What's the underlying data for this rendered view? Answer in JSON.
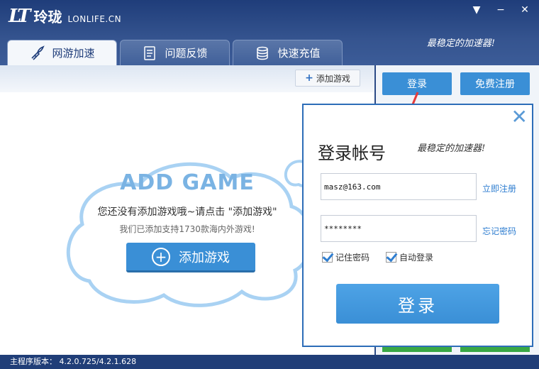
{
  "app": {
    "logo_mark": "LT",
    "logo_cn": "玲珑",
    "logo_en": "LONLIFE.CN",
    "slogan": "最稳定的加速器!"
  },
  "window": {
    "menu_icon": "▼",
    "minimize_icon": "−",
    "close_icon": "✕"
  },
  "tabs": [
    {
      "label": "网游加速",
      "icon": "rocket-icon"
    },
    {
      "label": "问题反馈",
      "icon": "feedback-icon"
    },
    {
      "label": "快速充值",
      "icon": "coins-icon"
    }
  ],
  "main": {
    "add_game_small": "添加游戏",
    "add_game_title": "ADD GAME",
    "line1": "您还没有添加游戏哦~请点击 \"添加游戏\"",
    "line2": "我们已添加支持1730款海内外游戏!",
    "add_game_button": "添加游戏"
  },
  "right_panel": {
    "login_button": "登录",
    "register_button": "免费注册"
  },
  "dialog": {
    "title": "登录帐号",
    "slogan": "最稳定的加速器!",
    "username": "masz@163.com",
    "password": "********",
    "register_link": "立即注册",
    "forgot_link": "忘记密码",
    "remember_label": "记住密码",
    "remember_checked": true,
    "autologin_label": "自动登录",
    "autologin_checked": true,
    "login_button": "登录",
    "close_icon": "✕"
  },
  "status": {
    "version_text": "主程序版本： 4.2.0.725/4.2.1.628"
  },
  "colors": {
    "accent": "#3a8fd6",
    "header": "#2b4a86",
    "annotation_arrow": "#e53b3b"
  }
}
